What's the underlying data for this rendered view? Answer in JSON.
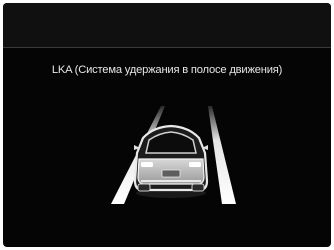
{
  "screen": {
    "title": "LKA (Система удержания в полосе движения)"
  },
  "colors": {
    "background": "#050505",
    "text": "#e6e6e6",
    "lane_line": "#ffffff"
  },
  "icons": [
    "lane-line-icon",
    "car-icon"
  ]
}
